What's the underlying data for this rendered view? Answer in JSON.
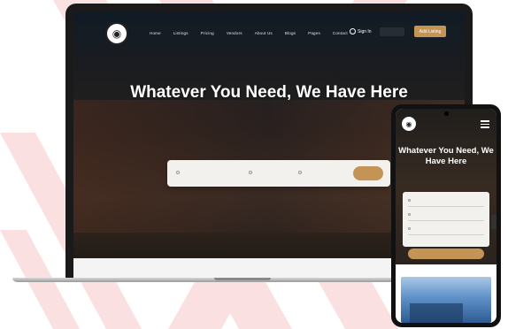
{
  "laptop": {
    "nav": {
      "menu": [
        "Home",
        "Listings",
        "Pricing",
        "Vendors",
        "About Us",
        "Blogs",
        "Pages",
        "Contact"
      ],
      "login_label": "Sign In",
      "cta_label": "Add Listing"
    },
    "hero": {
      "title": "Whatever You Need, We Have Here",
      "subtitle": ""
    },
    "search": {
      "keyword_placeholder": "",
      "location_placeholder": "",
      "category_placeholder": ""
    }
  },
  "phone": {
    "hero": {
      "title": "Whatever You Need, We Have Here",
      "subtitle": ""
    },
    "search_button_label": ""
  },
  "colors": {
    "accent": "#c49454",
    "watermark": "#e5484d"
  }
}
